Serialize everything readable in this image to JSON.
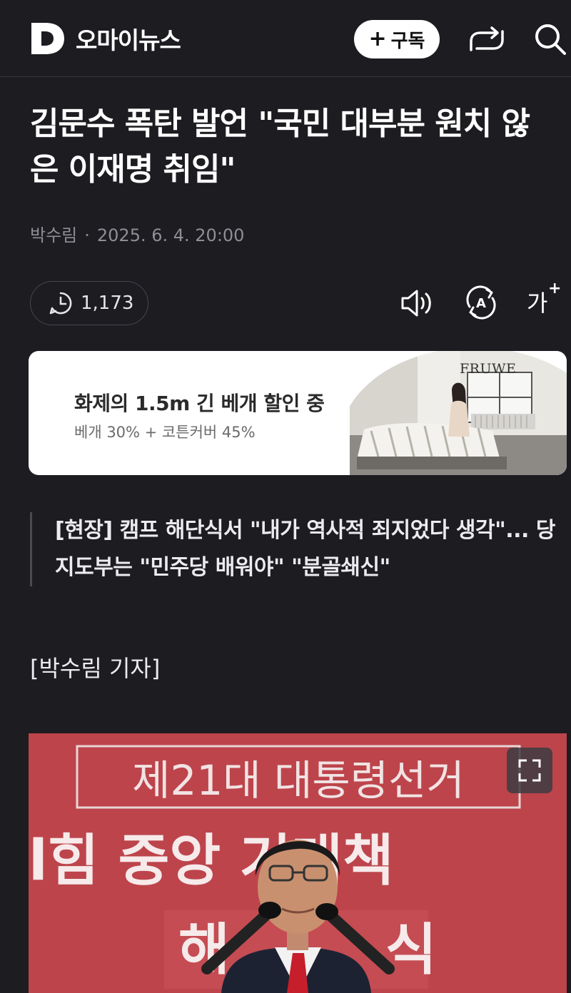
{
  "header": {
    "brand": "오마이뉴스",
    "subscribe_label": "구독",
    "icons": [
      "logo-d-icon",
      "plus-icon",
      "share-icon",
      "search-icon"
    ]
  },
  "article": {
    "title": "김문수 폭탄 발언 \"국민 대부분 원치 않은 이재명 취임\"",
    "author": "박수림",
    "separator": "·",
    "datetime": "2025. 6. 4. 20:00",
    "views": "1,173",
    "font_size_label": "가",
    "subheading": "[현장] 캠프 해단식서 \"내가 역사적 죄지었다 생각\"... 당지도부는 \"민주당 배워야\" \"분골쇄신\"",
    "reporter": "[박수림 기자]"
  },
  "ad": {
    "title": "화제의 1.5m 긴 베개 할인 중",
    "subtitle": "베개 30% + 코튼커버 45%",
    "brand": "FRUWE"
  },
  "photo": {
    "banner_top": "제21대 대통령선거",
    "banner_mid": "l힘 중앙  거대책"
  },
  "colors": {
    "background": "#1c1c21",
    "photo_red": "#b9434a"
  }
}
